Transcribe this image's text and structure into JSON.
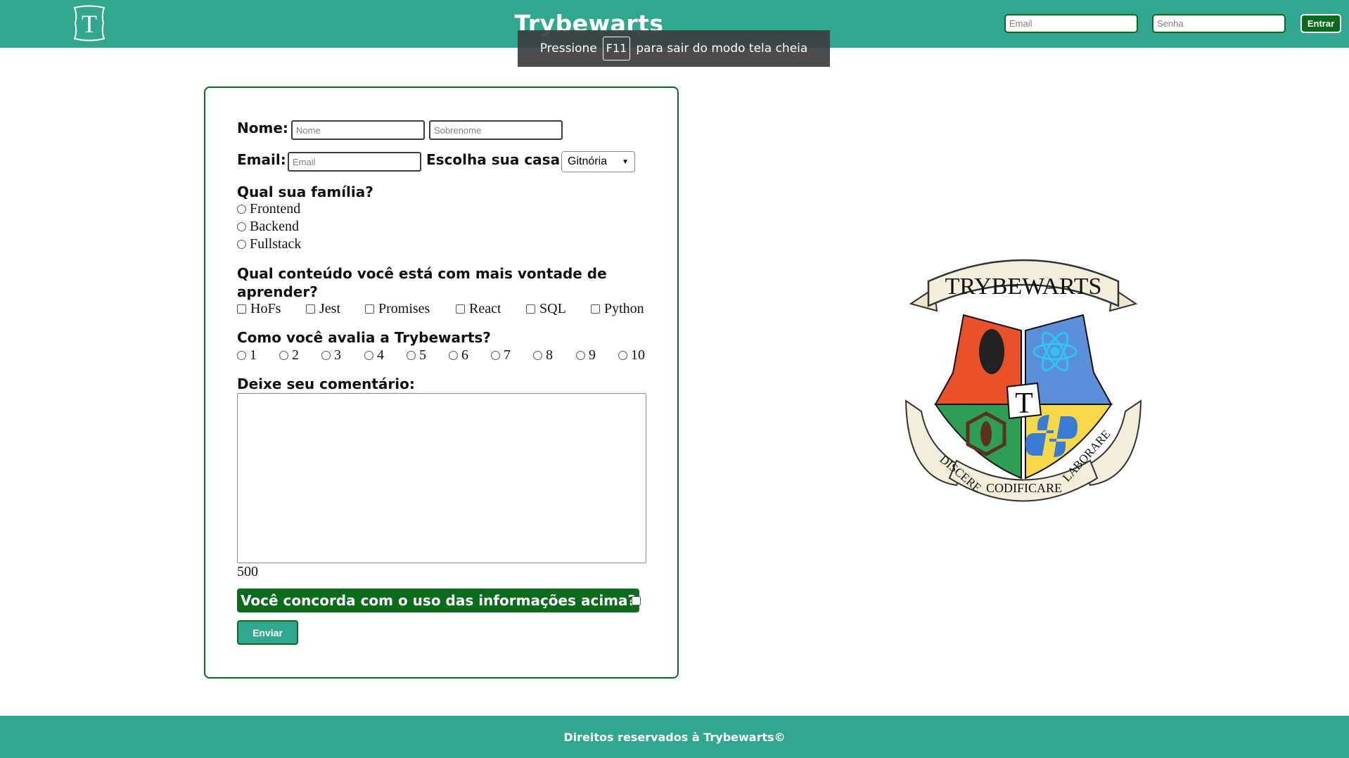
{
  "header": {
    "logo_letter": "T",
    "title": "Trybewarts",
    "login": {
      "email_placeholder": "Email",
      "password_placeholder": "Senha",
      "submit_label": "Entrar"
    }
  },
  "fullscreen_notice": {
    "prefix": "Pressione",
    "key": "F11",
    "suffix": "para sair do modo tela cheia"
  },
  "form": {
    "name_label": "Nome:",
    "first_name_placeholder": "Nome",
    "last_name_placeholder": "Sobrenome",
    "email_label": "Email:",
    "email_placeholder": "Email",
    "house_label": "Escolha sua casa:",
    "house_selected": "Gitnória",
    "family_label": "Qual sua família?",
    "family_options": [
      "Frontend",
      "Backend",
      "Fullstack"
    ],
    "content_label": "Qual conteúdo você está com mais vontade de aprender?",
    "content_options": [
      "HoFs",
      "Jest",
      "Promises",
      "React",
      "SQL",
      "Python"
    ],
    "rating_label": "Como você avalia a Trybewarts?",
    "rating_options": [
      "1",
      "2",
      "3",
      "4",
      "5",
      "6",
      "7",
      "8",
      "9",
      "10"
    ],
    "comment_label": "Deixe seu comentário:",
    "char_counter": "500",
    "agreement_label": "Você concorda com o uso das informações acima?",
    "submit_label": "Enviar"
  },
  "crest": {
    "banner_top": "TRYBEWARTS",
    "center_letter": "T",
    "motto_left": "DISCERE",
    "motto_center": "CODIFICARE",
    "motto_right": "LABORARE"
  },
  "footer": {
    "text": "Direitos reservados à Trybewarts©"
  },
  "colors": {
    "primary": "#31a78f",
    "dark_green": "#0b6b1c",
    "crest_red": "#e8512a",
    "crest_blue": "#5b8fd9",
    "crest_green": "#2f9e55",
    "crest_yellow": "#f6d84a",
    "parchment": "#f3eddc"
  }
}
